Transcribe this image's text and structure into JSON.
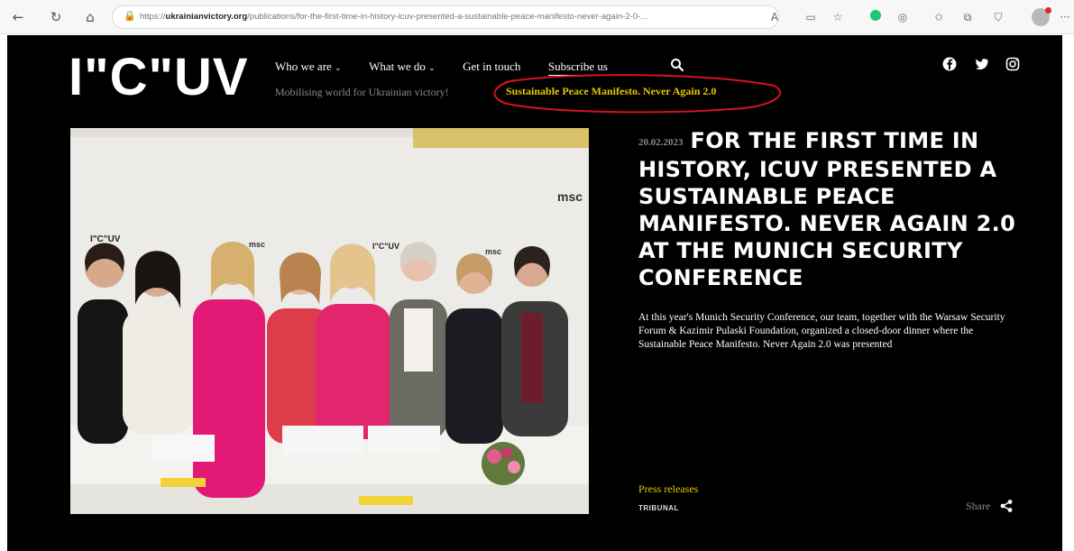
{
  "browser": {
    "url_prefix": "https://",
    "url_domain": "ukrainianvictory.org",
    "url_path": "/publications/for-the-first-time-in-history-icuv-presented-a-sustainable-peace-manifesto-never-again-2-0-...",
    "icons": [
      "back-icon",
      "refresh-icon",
      "home-icon",
      "lock-icon",
      "read-aloud-icon",
      "reader-view-icon",
      "favorite-icon",
      "extension-icon",
      "extensions-icon",
      "favorites-icon",
      "collections-icon",
      "shield-icon",
      "profile-icon",
      "more-icon"
    ],
    "glyphs": {
      "back": "←",
      "refresh": "↻",
      "home": "⌂",
      "lock": "🔒",
      "read_aloud": "A",
      "reader": "▭",
      "favorite": "☆",
      "ext": "◎",
      "favorites": "✩",
      "collections": "⧉",
      "shield": "⛉",
      "more": "···"
    },
    "ext_color": "#1ec87a"
  },
  "site": {
    "logo": "I\"C\"UV",
    "nav": {
      "who": "Who we are",
      "what": "What we do",
      "contact": "Get in touch",
      "subscribe": "Subscribe us"
    },
    "tagline": "Mobilising world for Ukrainian victory!",
    "manifesto_link": "Sustainable Peace Manifesto. Never Again 2.0",
    "social": [
      "facebook-icon",
      "twitter-icon",
      "instagram-icon"
    ],
    "accent_color": "#e6c800",
    "annotation_color": "#d4141b"
  },
  "article": {
    "date": "20.02.2023",
    "title": "FOR THE FIRST TIME IN HISTORY, ICUV PRESENTED A SUSTAINABLE PEACE MANIFESTO. NEVER AGAIN 2.0 AT THE MUNICH SECURITY CONFERENCE",
    "lead": "At this year's Munich Security Conference, our team, together with the Warsaw Security Forum & Kazimir Pulaski Foundation, organized a closed-door dinner where the Sustainable Peace Manifesto. Never Again 2.0 was presented",
    "category": "Press releases",
    "tag": "TRIBUNAL",
    "share_label": "Share"
  },
  "photo": {
    "backdrop_logos": [
      "I\"C\"UV",
      "msc",
      "msc",
      "I\"C\"UV",
      "msc"
    ]
  }
}
